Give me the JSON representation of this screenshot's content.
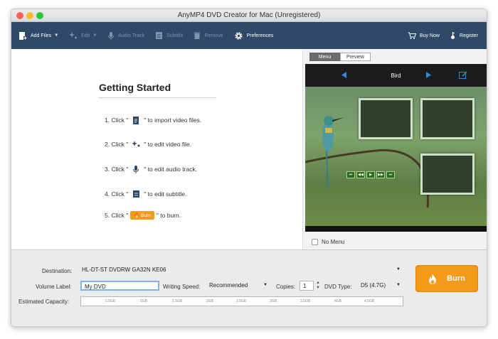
{
  "window": {
    "title": "AnyMP4 DVD Creator for Mac (Unregistered)"
  },
  "toolbar": {
    "add_files": "Add Files",
    "edit": "Edit",
    "audio_track": "Audio Track",
    "subtitle": "Subtitle",
    "remove": "Remove",
    "preferences": "Preferences",
    "buy_now": "Buy Now",
    "register": "Register"
  },
  "getting_started": {
    "title": "Getting Started",
    "steps": [
      {
        "prefix": "1. Click \"",
        "suffix": "\" to import video files.",
        "icon": "add-file-icon"
      },
      {
        "prefix": "2. Click \"",
        "suffix": "\" to edit video file.",
        "icon": "edit-sparkle-icon"
      },
      {
        "prefix": "3. Click \"",
        "suffix": "\" to edit audio track.",
        "icon": "microphone-icon"
      },
      {
        "prefix": "4. Click \"",
        "suffix": "\" to edit subtitle.",
        "icon": "subtitle-icon"
      },
      {
        "prefix": "5. Click \"",
        "suffix": "\" to burn.",
        "icon": "burn-icon"
      }
    ],
    "burn_mini_label": "Burn"
  },
  "preview": {
    "tabs": [
      "Menu",
      "Preview"
    ],
    "active_tab": "Menu",
    "menu_title": "Bird",
    "no_menu_label": "No Menu"
  },
  "bottom": {
    "destination_label": "Destination:",
    "destination_value": "HL-DT-ST DVDRW  GA32N KE06",
    "volume_label": "Volume Label:",
    "volume_value": "My DVD",
    "writing_speed_label": "Writing Speed:",
    "writing_speed_value": "Recommended",
    "copies_label": "Copies:",
    "copies_value": "1",
    "dvd_type_label": "DVD Type:",
    "dvd_type_value": "D5 (4.7G)",
    "estimated_capacity_label": "Estimated Capacity:",
    "capacity_ticks": [
      "0.5GB",
      "1GB",
      "1.5GB",
      "2GB",
      "2.5GB",
      "3GB",
      "3.5GB",
      "4GB",
      "4.5GB"
    ],
    "burn_label": "Burn"
  },
  "colors": {
    "toolbar_bg": "#2f4a68",
    "accent_orange": "#f39a1a",
    "preview_bg": "#111111"
  }
}
